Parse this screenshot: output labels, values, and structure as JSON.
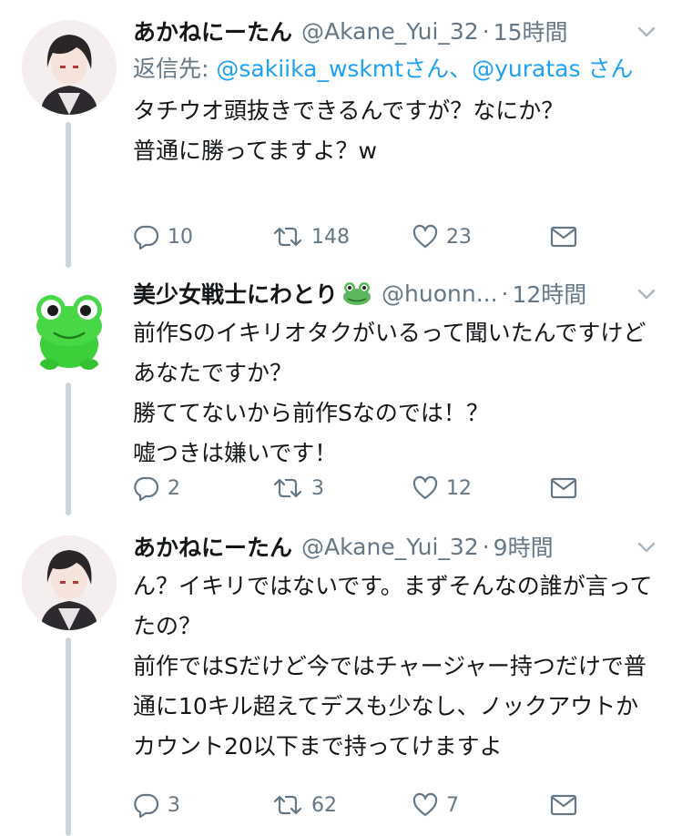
{
  "tweets": [
    {
      "name": "あかねにーたん",
      "handle": "@Akane_Yui_32",
      "time": "15時間",
      "reply_prefix": "返信先: ",
      "reply_users": [
        "@sakiika_wskmtさん",
        "@yuratas さん"
      ],
      "reply_sep": "、",
      "text": "タチウオ頭抜きできるんですが？なにか？\n普通に勝ってますよ？w",
      "replies": "10",
      "retweets": "148",
      "likes": "23"
    },
    {
      "name": "美少女戦士にわとり",
      "name_emoji": "frog-emoji",
      "handle": "@huonn...",
      "time": "12時間",
      "text": "前作Sのイキリオタクがいるって聞いたんですけどあなたですか？\n勝ててないから前作Sなのでは！？\n嘘つきは嫌いです！",
      "replies": "2",
      "retweets": "3",
      "likes": "12"
    },
    {
      "name": "あかねにーたん",
      "handle": "@Akane_Yui_32",
      "time": "9時間",
      "text": "ん？イキリではないです。まずそんなの誰が言ってたの？\n前作ではSだけど今ではチャージャー持つだけで普通に10キル超えてデスも少なし、ノックアウトかカウント20以下まで持ってけますよ",
      "replies": "3",
      "retweets": "62",
      "likes": "7"
    }
  ],
  "separator": "·",
  "colors": {
    "text": "#14171a",
    "secondary": "#657786",
    "link": "#1da1f2",
    "thread_line": "#ccd6dd"
  },
  "icons": [
    "chevron-down-icon",
    "reply-icon",
    "retweet-icon",
    "like-icon",
    "dm-icon"
  ]
}
